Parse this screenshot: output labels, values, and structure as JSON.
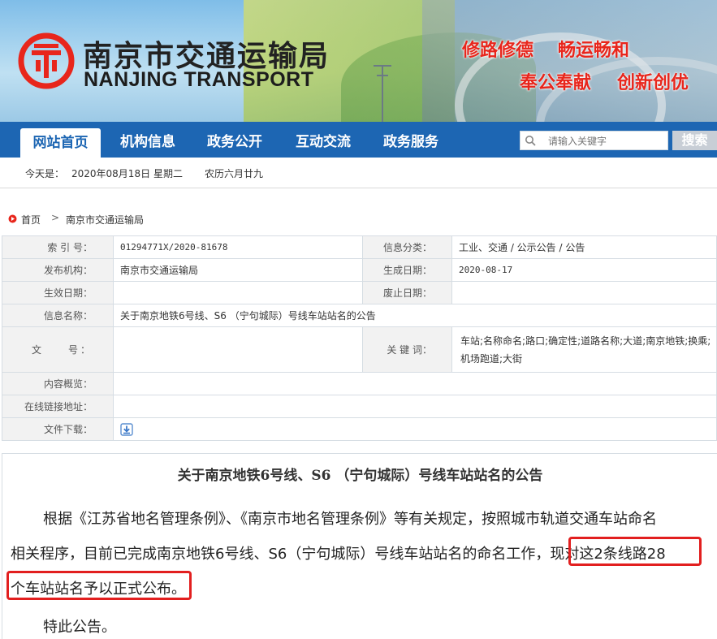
{
  "header": {
    "site_name": "南京市交通运输局",
    "site_name_en": "NANJING TRANSPORT",
    "slogans": [
      "修路修德",
      "畅运畅和",
      "奉公奉献",
      "创新创优"
    ],
    "brand_red": "#e8261c"
  },
  "nav": {
    "items": [
      {
        "label": "网站首页",
        "active": true
      },
      {
        "label": "机构信息",
        "active": false
      },
      {
        "label": "政务公开",
        "active": false
      },
      {
        "label": "互动交流",
        "active": false
      },
      {
        "label": "政务服务",
        "active": false
      }
    ],
    "color": "#1d66b3",
    "search_placeholder": "请输入关键字",
    "search_button": "搜索"
  },
  "datebar": {
    "today_label": "今天是：",
    "date": "2020年08月18日",
    "weekday": "星期二",
    "lunar": "农历六月廿九"
  },
  "breadcrumb": {
    "home": "首页",
    "separator": ">",
    "current": "南京市交通运输局"
  },
  "info": {
    "index_label": "索 引 号：",
    "index_value": "01294771X/2020-81678",
    "category_label": "信息分类：",
    "category_value": "工业、交通 / 公示公告 / 公告",
    "publisher_label": "发布机构：",
    "publisher_value": "南京市交通运输局",
    "created_label": "生成日期：",
    "created_value": "2020-08-17",
    "effective_label": "生效日期：",
    "effective_value": "",
    "expire_label": "废止日期：",
    "expire_value": "",
    "name_label": "信息名称：",
    "name_value": "关于南京地铁6号线、S6 （宁句城际）号线车站站名的公告",
    "docno_label": "文　　号：",
    "docno_value": "",
    "keywords_label": "关 键 词：",
    "keywords_value": "车站;名称命名;路口;确定性;道路名称;大道;南京地铁;换乘;机场跑道;大街",
    "summary_label": "内容概览：",
    "summary_value": "",
    "link_label": "在线链接地址：",
    "link_value": "",
    "download_label": "文件下载：",
    "download_icon": "download-icon"
  },
  "article": {
    "title": "关于南京地铁6号线、S6 （宁句城际）号线车站站名的公告",
    "line1": "根据《江苏省地名管理条例》、《南京市地名管理条例》等有关规定，按照城市轨道交通车站命名",
    "line2_plain": "相关程序，目前已完成南京地铁6号线、S6（宁句城际）号线车站站名的命名工作，",
    "line2_highlight": "现对这2条线路28",
    "line3_highlight": "个车站站名予以正式公布。",
    "line4": "特此公告。",
    "highlight_color": "#e21f1f"
  }
}
